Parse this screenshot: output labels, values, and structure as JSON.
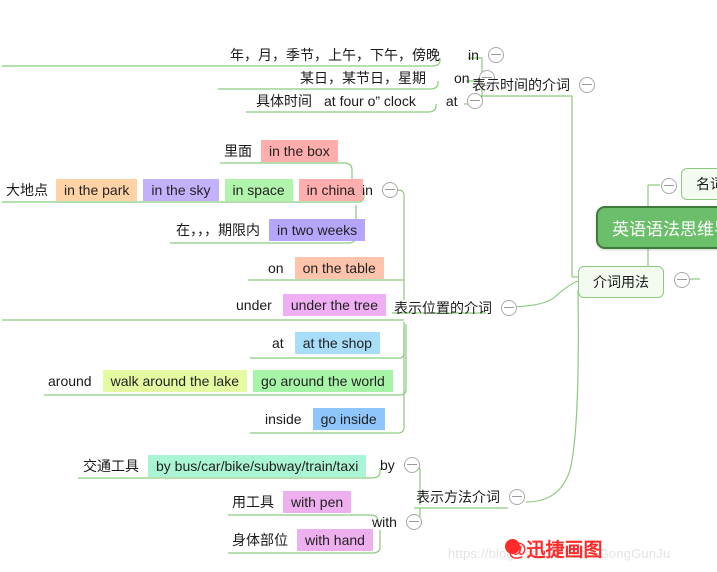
{
  "central": {
    "title": "英语语法思维导图"
  },
  "branches": {
    "noun": {
      "label": "名词"
    },
    "preposition_usage": {
      "label": "介词用法"
    },
    "time": {
      "label": "表示时间的介词"
    },
    "place": {
      "label": "表示位置的介词"
    },
    "method": {
      "label": "表示方法介词"
    }
  },
  "prepositions": {
    "in_time": "in",
    "on_time": "on",
    "at_time": "at",
    "in_place": "in",
    "on_place": "on",
    "under": "under",
    "at_place": "at",
    "around": "around",
    "inside": "inside",
    "by": "by",
    "with": "with"
  },
  "time_rows": [
    {
      "cn": "年，月，季节，上午，下午，傍晚",
      "prep": "in"
    },
    {
      "cn": "某日，某节日，星期",
      "prep": "on"
    },
    {
      "cn": "具体时间",
      "example": "at four o” clock",
      "prep": "at"
    }
  ],
  "place_in_rows": [
    {
      "cn": "里面",
      "items": [
        {
          "text": "in the box",
          "color": "#ffadad"
        }
      ]
    },
    {
      "cn": "大地点",
      "items": [
        {
          "text": "in the park",
          "color": "#ffd3a6"
        },
        {
          "text": "in the sky",
          "color": "#c3b1fc"
        },
        {
          "text": "in space",
          "color": "#b0f5ab"
        },
        {
          "text": "in china",
          "color": "#ffadad"
        }
      ]
    },
    {
      "cn": "在，，，期限内",
      "items": [
        {
          "text": "in two weeks",
          "color": "#b6a6fb"
        }
      ]
    }
  ],
  "place_rows": [
    {
      "prep": "on",
      "items": [
        {
          "text": "on the table",
          "color": "#ffc4ab"
        }
      ]
    },
    {
      "prep": "under",
      "items": [
        {
          "text": "under the tree",
          "color": "#f0aef5"
        }
      ]
    },
    {
      "prep": "at",
      "items": [
        {
          "text": "at the shop",
          "color": "#a8ddfa"
        }
      ]
    },
    {
      "prep": "around",
      "items": [
        {
          "text": "walk around the lake",
          "color": "#e4fba2"
        },
        {
          "text": "go around the world",
          "color": "#a6f5a6"
        }
      ]
    },
    {
      "prep": "inside",
      "items": [
        {
          "text": "go inside",
          "color": "#8ec5fa"
        }
      ]
    }
  ],
  "method_rows": [
    {
      "cn": "交通工具",
      "items": [
        {
          "text": "by bus/car/bike/subway/train/taxi",
          "color": "#a9f5d4"
        }
      ],
      "prep": "by"
    },
    {
      "cn": "用工具",
      "items": [
        {
          "text": "with pen",
          "color": "#eeafee"
        }
      ],
      "prep": "with"
    },
    {
      "cn": "身体部位",
      "items": [
        {
          "text": "with hand",
          "color": "#eeafee"
        }
      ],
      "prep": ""
    }
  ],
  "watermark": {
    "url": "https://blog.csdn.net/ban GongGunJu",
    "brand": "@迅捷画图"
  },
  "colors": {
    "branch_line": "#8cc97f",
    "central_bg": "#6cbf6a",
    "central_border": "#3f7a3d",
    "branch_box_bg": "#f3fbf1"
  }
}
